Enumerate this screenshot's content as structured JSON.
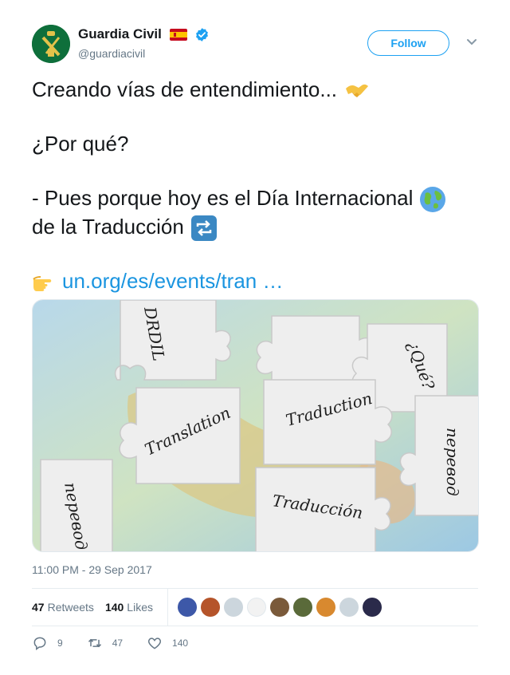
{
  "user": {
    "display_name": "Guardia Civil",
    "handle": "@guardiacivil",
    "flag_icon": "spain-flag-icon",
    "verified_icon": "verified-badge-icon"
  },
  "header": {
    "follow_label": "Follow"
  },
  "tweet": {
    "line1": "Creando vías de entendimiento...",
    "line2": "¿Por qué?",
    "line3": "- Pues porque hoy es el Día Internacional",
    "line4": "de la Traducción",
    "link": "un.org/es/events/tran …"
  },
  "media": {
    "words": [
      "Traduction",
      "Translation",
      "Traducción",
      "перевод",
      "¿Qué?",
      "DRDIL",
      "перевод"
    ]
  },
  "meta": {
    "timestamp": "11:00 PM - 29 Sep 2017"
  },
  "stats": {
    "retweets_count": "47",
    "retweets_label": "Retweets",
    "likes_count": "140",
    "likes_label": "Likes"
  },
  "actions": {
    "reply_count": "9",
    "retweet_count": "47",
    "like_count": "140"
  },
  "colors": {
    "accent": "#1da1f2",
    "link": "#1b95e0",
    "muted": "#657786"
  }
}
